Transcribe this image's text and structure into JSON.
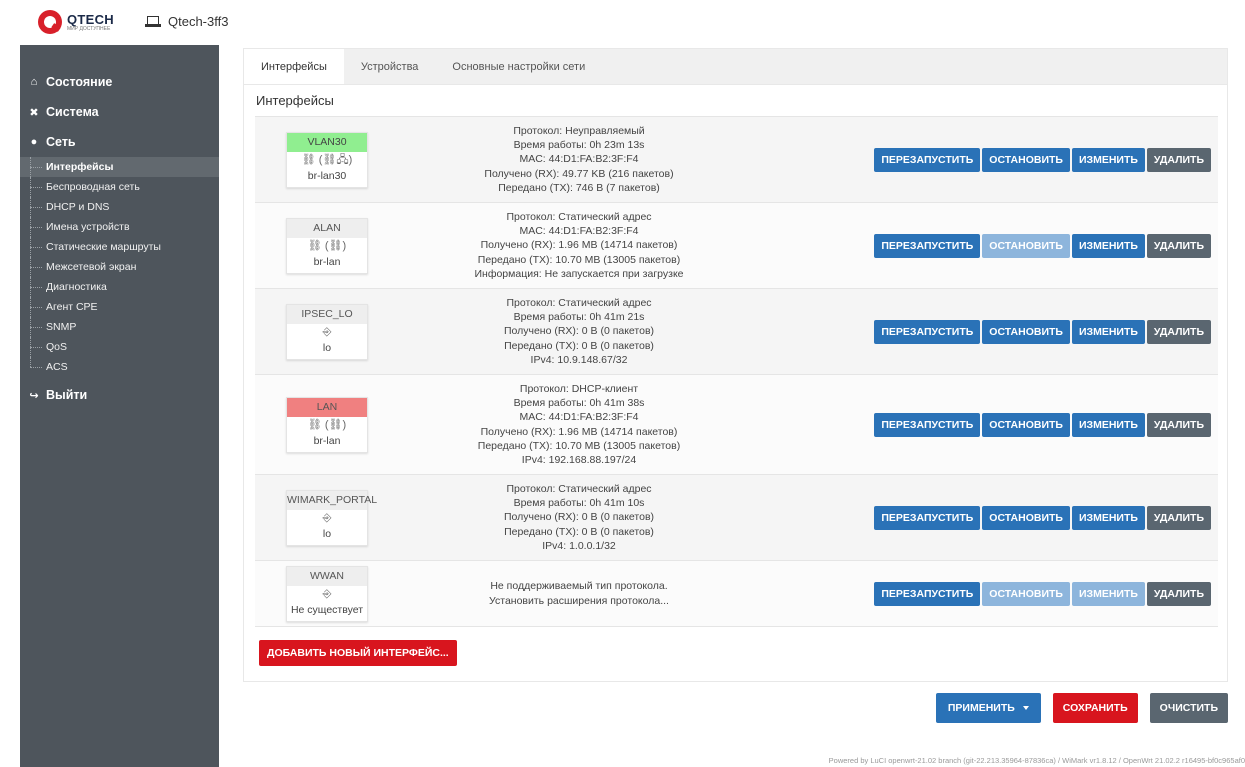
{
  "header": {
    "logo_name": "QTECH",
    "logo_sub": "МИР ДОСТУПНЕЕ",
    "hostname": "Qtech-3ff3"
  },
  "sidebar": {
    "top": [
      {
        "label": "Состояние",
        "icon": "home-icon"
      },
      {
        "label": "Система",
        "icon": "wrench-icon"
      },
      {
        "label": "Сеть",
        "icon": "globe-icon"
      }
    ],
    "network_items": [
      "Интерфейсы",
      "Беспроводная сеть",
      "DHCP и DNS",
      "Имена устройств",
      "Статические маршруты",
      "Межсетевой экран",
      "Диагностика",
      "Агент CPE",
      "SNMP",
      "QoS",
      "ACS"
    ],
    "logout": {
      "label": "Выйти",
      "icon": "logout-icon"
    }
  },
  "tabs": [
    "Интерфейсы",
    "Устройства",
    "Основные настройки сети"
  ],
  "section_title": "Интерфейсы",
  "buttons": {
    "restart": "ПЕРЕЗАПУСТИТЬ",
    "stop": "ОСТАНОВИТЬ",
    "edit": "ИЗМЕНИТЬ",
    "delete": "УДАЛИТЬ",
    "add": "ДОБАВИТЬ НОВЫЙ ИНТЕРФЕЙС...",
    "apply": "ПРИМЕНИТЬ",
    "save": "СОХРАНИТЬ",
    "reset": "ОЧИСТИТЬ"
  },
  "interfaces": [
    {
      "name": "VLAN30",
      "icons": "⛓ (⛓🖧)",
      "device": "br-lan30",
      "lines": [
        "Протокол: Неуправляемый",
        "Время работы: 0h 23m 13s",
        "MAC: 44:D1:FA:B2:3F:F4",
        "Получено (RX): 49.77 KB (216 пакетов)",
        "Передано (TX): 746 B (7 пакетов)"
      ]
    },
    {
      "name": "ALAN",
      "icons": "⛓ (⛓)",
      "device": "br-lan",
      "lines": [
        "Протокол: Статический адрес",
        "MAC: 44:D1:FA:B2:3F:F4",
        "Получено (RX): 1.96 MB (14714 пакетов)",
        "Передано (TX): 10.70 MB (13005 пакетов)",
        "Информация: Не запускается при загрузке"
      ]
    },
    {
      "name": "IPSEC_LO",
      "icons": "⎆",
      "device": "lo",
      "lines": [
        "Протокол: Статический адрес",
        "Время работы: 0h 41m 21s",
        "Получено (RX): 0 B (0 пакетов)",
        "Передано (TX): 0 B (0 пакетов)",
        "IPv4: 10.9.148.67/32"
      ]
    },
    {
      "name": "LAN",
      "icons": "⛓ (⛓)",
      "device": "br-lan",
      "lines": [
        "Протокол: DHCP-клиент",
        "Время работы: 0h 41m 38s",
        "MAC: 44:D1:FA:B2:3F:F4",
        "Получено (RX): 1.96 MB (14714 пакетов)",
        "Передано (TX): 10.70 MB (13005 пакетов)",
        "IPv4: 192.168.88.197/24"
      ]
    },
    {
      "name": "WIMARK_PORTAL",
      "icons": "⎆",
      "device": "lo",
      "lines": [
        "Протокол: Статический адрес",
        "Время работы: 0h 41m 10s",
        "Получено (RX): 0 B (0 пакетов)",
        "Передано (TX): 0 B (0 пакетов)",
        "IPv4: 1.0.0.1/32"
      ]
    },
    {
      "name": "WWAN",
      "icons": "⎆",
      "device": "Не существует",
      "lines": [
        "Не поддерживаемый тип протокола.",
        "Установить расширения протокола..."
      ]
    }
  ],
  "footer": "Powered by LuCI openwrt-21.02 branch (git-22.213.35964-87836ca) / WiMark vr1.8.12 / OpenWrt 21.02.2 r16495-bf0c965af0",
  "colors": {
    "sidebar_bg": "#4e555c",
    "accent_blue": "#2a72b7",
    "danger_red": "#d8151e",
    "status_up": "#90ee90",
    "status_down": "#f08080"
  }
}
